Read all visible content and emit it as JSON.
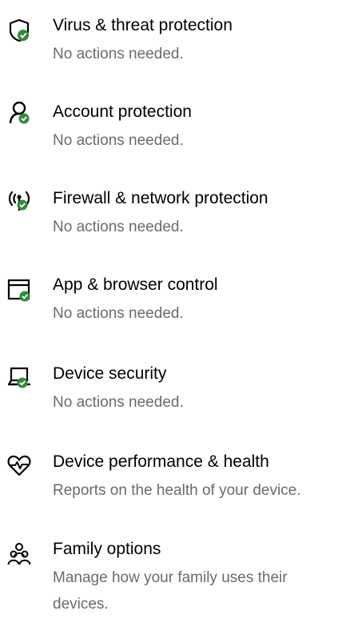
{
  "items": [
    {
      "title": "Virus & threat protection",
      "description": "No actions needed.",
      "icon": "shield-check-icon"
    },
    {
      "title": "Account protection",
      "description": "No actions needed.",
      "icon": "person-check-icon"
    },
    {
      "title": "Firewall & network protection",
      "description": "No actions needed.",
      "icon": "wireless-antenna-check-icon"
    },
    {
      "title": "App & browser control",
      "description": "No actions needed.",
      "icon": "app-window-check-icon"
    },
    {
      "title": "Device security",
      "description": "No actions needed.",
      "icon": "laptop-check-icon"
    },
    {
      "title": "Device performance & health",
      "description": "Reports on the health of your device.",
      "icon": "heart-pulse-icon"
    },
    {
      "title": "Family options",
      "description": "Manage how your family uses their devices.",
      "icon": "family-icon"
    }
  ],
  "colors": {
    "status_ok": "#2e8b3d",
    "icon_stroke": "#000000",
    "title_text": "#000000",
    "description_text": "#6b6b6b"
  }
}
